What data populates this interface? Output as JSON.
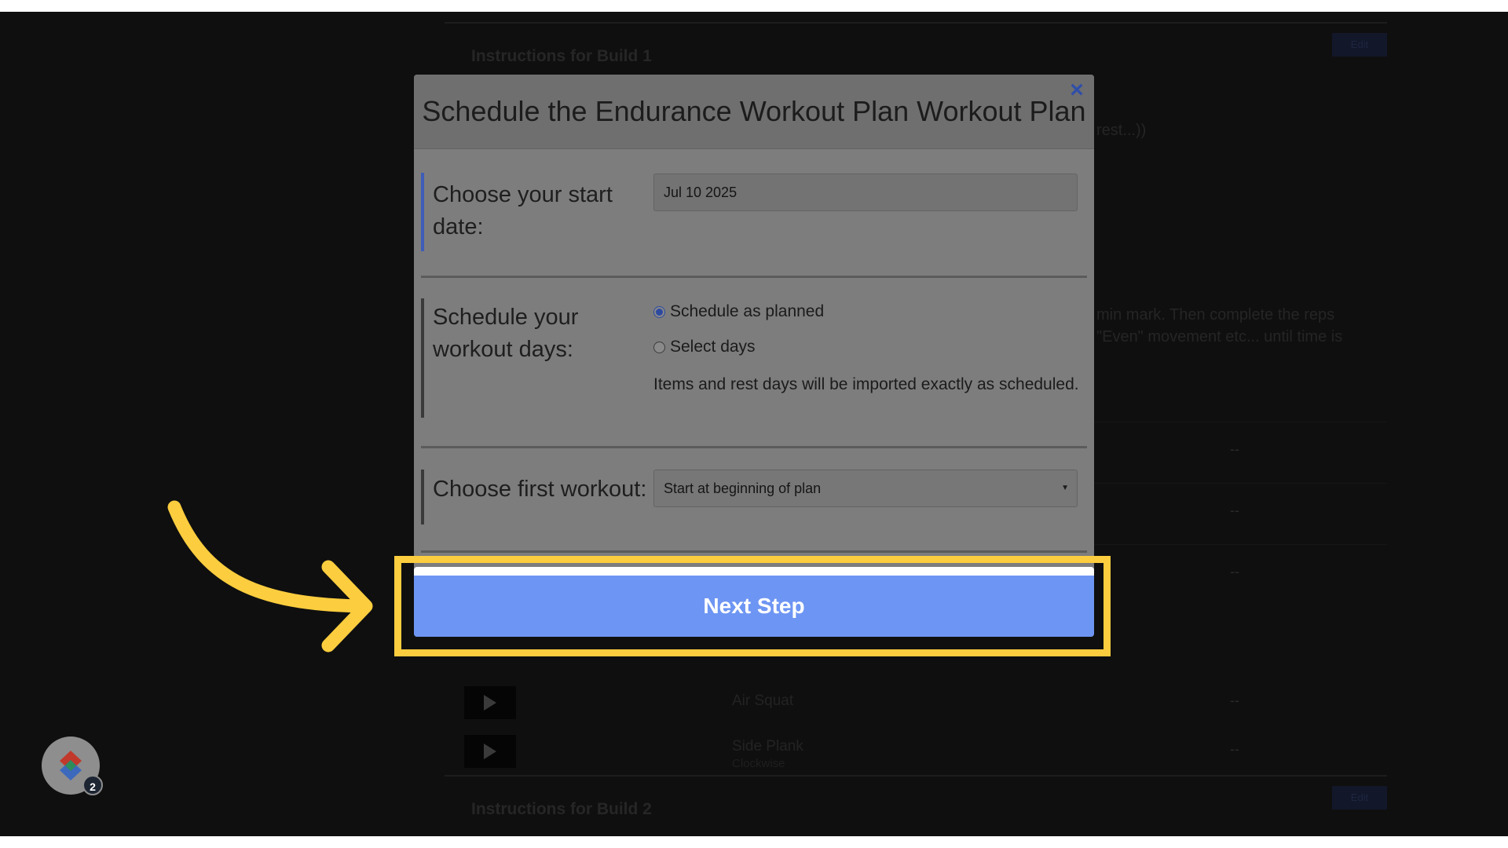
{
  "background_page": {
    "build_titles": [
      "Instructions for Build 1",
      "Instructions for Build 2"
    ],
    "build_button_label": "Edit",
    "snippets": [
      "rest...))",
      "min mark. Then complete the reps",
      "\"Even\" movement etc... until time is"
    ],
    "rows": [
      {
        "name": "",
        "sub": "",
        "dash": "--"
      },
      {
        "name": "",
        "sub": "",
        "dash": "--"
      },
      {
        "name": "",
        "sub": "",
        "dash": "--"
      },
      {
        "name": "Air Squat",
        "sub": "",
        "dash": "--"
      },
      {
        "name": "Side Plank",
        "sub": "Clockwise",
        "dash": "--"
      }
    ]
  },
  "modal": {
    "title": "Schedule the Endurance Workout Plan Workout Plan",
    "close_icon": "×",
    "start_date": {
      "label_line1": "Choose your start",
      "label_line2": "date:",
      "value": "Jul 10 2025"
    },
    "workout_days": {
      "label_line1": "Schedule your",
      "label_line2": "workout days:",
      "options": [
        "Schedule as planned",
        "Select days"
      ],
      "selected_index": 0,
      "help_text": "Items and rest days will be imported exactly as scheduled."
    },
    "first_workout": {
      "label": "Choose first workout:",
      "selected": "Start at beginning of plan"
    },
    "next_button": "Next Step"
  },
  "avatar": {
    "badge_count": "2"
  },
  "colors": {
    "highlight": "#fccd3e",
    "primary_button": "#6d95f3",
    "close_icon": "#2f4fa8"
  }
}
